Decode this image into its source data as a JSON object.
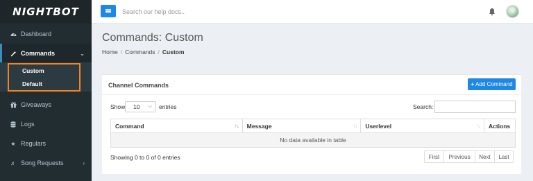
{
  "brand": {
    "name": "NIGHTBOT"
  },
  "header": {
    "search_placeholder": "Search our help docs.."
  },
  "sidebar": {
    "items": [
      {
        "label": "Dashboard",
        "icon": "tachometer-icon"
      },
      {
        "label": "Commands",
        "icon": "magic-wand-icon",
        "expanded": true
      },
      {
        "label": "Giveaways",
        "icon": "gift-icon"
      },
      {
        "label": "Logs",
        "icon": "database-icon"
      },
      {
        "label": "Regulars",
        "icon": "star-icon"
      },
      {
        "label": "Song Requests",
        "icon": "music-icon"
      }
    ],
    "submenu": [
      {
        "label": "Custom"
      },
      {
        "label": "Default"
      }
    ]
  },
  "page": {
    "title": "Commands: Custom",
    "breadcrumb": [
      "Home",
      "Commands",
      "Custom"
    ]
  },
  "card": {
    "title": "Channel Commands",
    "add_button": "Add Command",
    "show_label": "Show",
    "show_value": "10",
    "entries_label": "entries",
    "search_label": "Search:",
    "columns": [
      "Command",
      "Message",
      "Userlevel",
      "Actions"
    ],
    "empty_text": "No data available in table",
    "info": "Showing 0 to 0 of 0 entries",
    "pager": [
      "First",
      "Previous",
      "Next",
      "Last"
    ]
  },
  "colors": {
    "accent": "#1e88e5",
    "sidebar": "#222d32",
    "highlight": "#f58220"
  }
}
